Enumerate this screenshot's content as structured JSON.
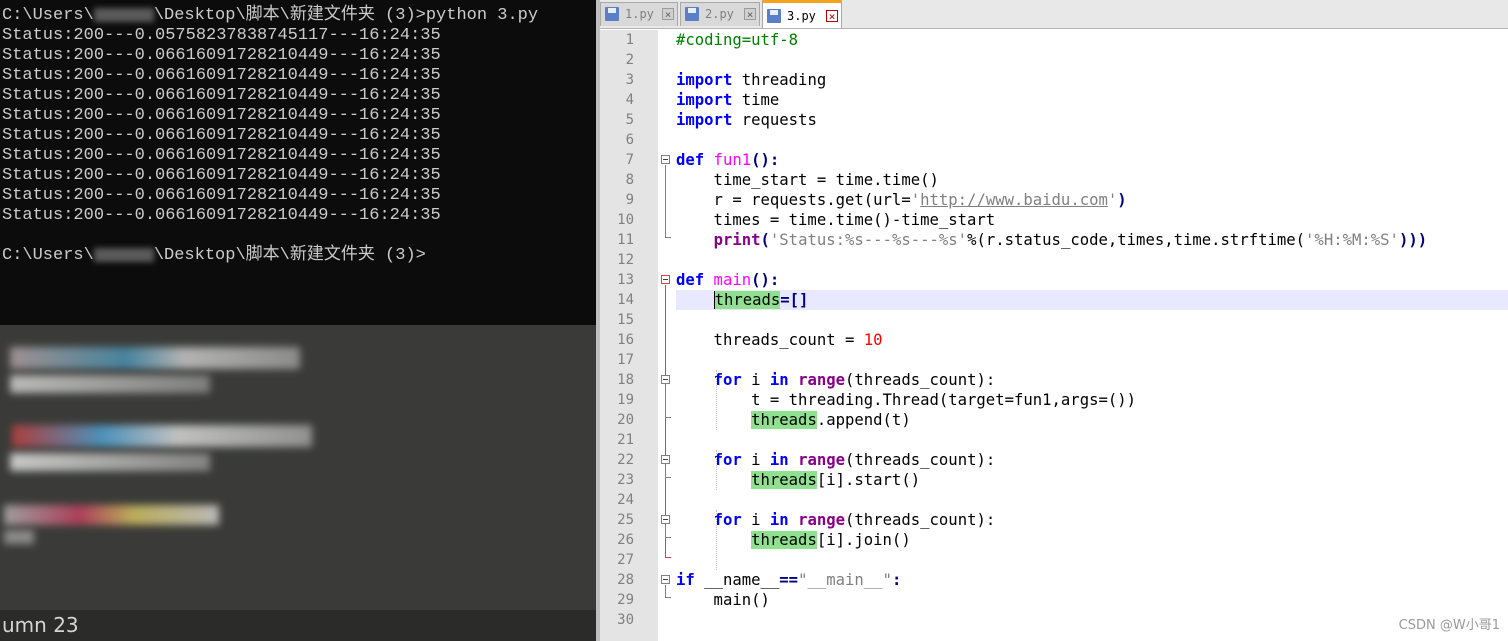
{
  "console": {
    "prompt1": "C:\\Users\\",
    "prompt1_tail": "\\Desktop\\脚本\\新建文件夹 (3)>python 3.py",
    "output": [
      "Status:200---0.05758237838745117---16:24:35",
      "Status:200---0.06616091728210449---16:24:35",
      "Status:200---0.06616091728210449---16:24:35",
      "Status:200---0.06616091728210449---16:24:35",
      "Status:200---0.06616091728210449---16:24:35",
      "Status:200---0.06616091728210449---16:24:35",
      "Status:200---0.06616091728210449---16:24:35",
      "Status:200---0.06616091728210449---16:24:35",
      "Status:200---0.06616091728210449---16:24:35",
      "Status:200---0.06616091728210449---16:24:35"
    ],
    "prompt2": "C:\\Users\\",
    "prompt2_tail": "\\Desktop\\脚本\\新建文件夹 (3)>"
  },
  "background_statusbar": "umn 23",
  "tabs": [
    {
      "label": "1.py",
      "active": false
    },
    {
      "label": "2.py",
      "active": false
    },
    {
      "label": "3.py",
      "active": true
    }
  ],
  "line_numbers": [
    "1",
    "2",
    "3",
    "4",
    "5",
    "6",
    "7",
    "8",
    "9",
    "10",
    "11",
    "12",
    "13",
    "14",
    "15",
    "16",
    "17",
    "18",
    "19",
    "20",
    "21",
    "22",
    "23",
    "24",
    "25",
    "26",
    "27",
    "28",
    "29",
    "30"
  ],
  "code": {
    "l1": "#coding=utf-8",
    "l3_kw": "import",
    "l3_mod": " threading",
    "l4_kw": "import",
    "l4_mod": " time",
    "l5_kw": "import",
    "l5_mod": " requests",
    "l7_kw": "def",
    "l7_fn": " fun1",
    "l7_rest": "():",
    "l8": "    time_start = time.time()",
    "l9_a": "    r = requests.get(url=",
    "l9_q1": "'",
    "l9_url": "http://www.baidu.com",
    "l9_q2": "'",
    "l9_b": ")",
    "l10": "    times = time.time()-time_start",
    "l11_kw": "print",
    "l11_s1": "'Status:%s---%s---%s'",
    "l11_mid": "%(r.status_code,times,time.strftime(",
    "l11_s2": "'%H:%M:%S'",
    "l11_end": ")))",
    "l13_kw": "def",
    "l13_fn": " main",
    "l13_rest": "():",
    "l14_var": "threads",
    "l14_rest": "=[]",
    "l16_a": "    threads_count = ",
    "l16_num": "10",
    "l18_kw": "for",
    "l18_a": " i ",
    "l18_in": "in",
    "l18_range": " range",
    "l18_b": "(threads_count):",
    "l19": "        t = threading.Thread(target=fun1,args=())",
    "l20_var": "threads",
    "l20_rest": ".append(t)",
    "l22_kw": "for",
    "l22_a": " i ",
    "l22_in": "in",
    "l22_range": " range",
    "l22_b": "(threads_count):",
    "l23_var": "threads",
    "l23_rest": "[i].start()",
    "l25_kw": "for",
    "l25_a": " i ",
    "l25_in": "in",
    "l25_range": " range",
    "l25_b": "(threads_count):",
    "l26_var": "threads",
    "l26_rest": "[i].join()",
    "l28_kw": "if",
    "l28_a": " __name__",
    "l28_op": "==",
    "l28_str": "\"__main__\"",
    "l28_b": ":",
    "l29": "    main()"
  },
  "watermark": "CSDN @W小哥1",
  "colors": {
    "keyword": "#0000ff",
    "function_name": "#ff00ff",
    "string": "#808080",
    "number": "#ff0000",
    "comment": "#008000",
    "highlight": "#8fe08f",
    "active_tab": "#f4a321"
  }
}
